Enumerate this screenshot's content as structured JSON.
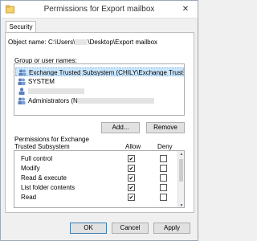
{
  "window": {
    "title": "Permissions for Export mailbox",
    "close_glyph": "✕",
    "icon": "security-shield-icon"
  },
  "tab": {
    "label": "Security"
  },
  "object": {
    "label": "Object name:",
    "value_prefix": "C:\\Users\\",
    "value_suffix": "\\Desktop\\Export mailbox"
  },
  "group": {
    "label": "Group or user names:",
    "users": [
      {
        "name": "Exchange Trusted Subsystem (CHILY\\Exchange Trusted S...",
        "selected": true,
        "icon": "group-icon"
      },
      {
        "name": "SYSTEM",
        "selected": false,
        "icon": "group-icon"
      },
      {
        "name": "",
        "selected": false,
        "icon": "user-icon"
      },
      {
        "name": "Administrators (N",
        "selected": false,
        "icon": "group-icon"
      }
    ]
  },
  "buttons": {
    "add": "Add...",
    "remove": "Remove",
    "ok": "OK",
    "cancel": "Cancel",
    "apply": "Apply"
  },
  "permissions": {
    "title_line1": "Permissions for Exchange",
    "title_line2": "Trusted Subsystem",
    "allow_header": "Allow",
    "deny_header": "Deny",
    "rows": [
      {
        "name": "Full control",
        "allow": true,
        "deny": false
      },
      {
        "name": "Modify",
        "allow": true,
        "deny": false
      },
      {
        "name": "Read & execute",
        "allow": true,
        "deny": false
      },
      {
        "name": "List folder contents",
        "allow": true,
        "deny": false
      },
      {
        "name": "Read",
        "allow": true,
        "deny": false
      }
    ]
  }
}
